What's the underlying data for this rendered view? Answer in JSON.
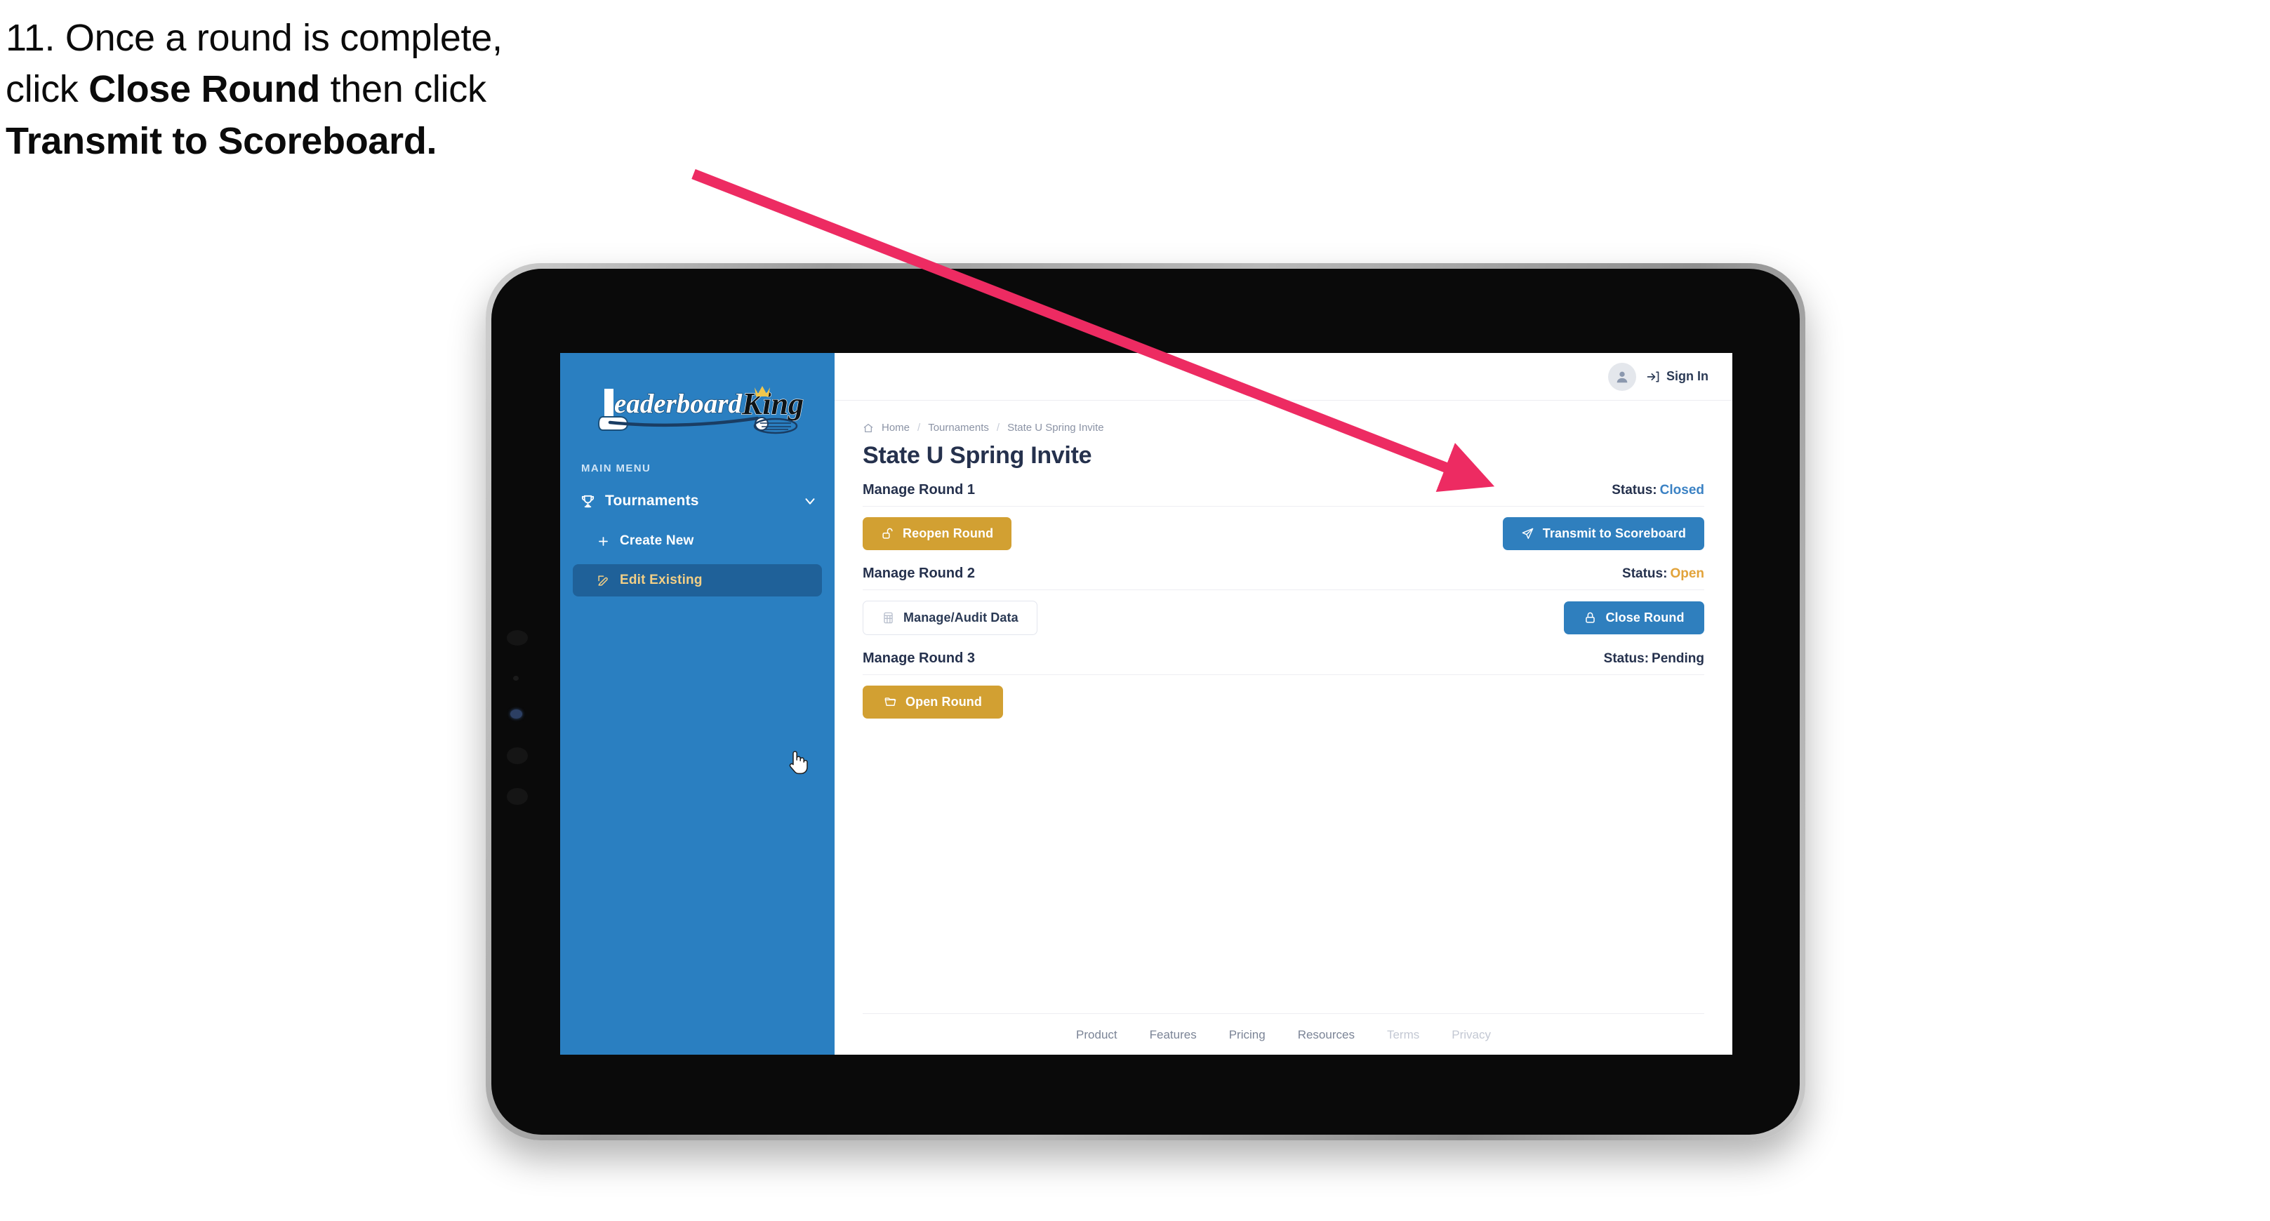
{
  "annotation": {
    "step_number": "11.",
    "line1_prefix": "11. Once a round is complete,",
    "line2_prefix": "click ",
    "line2_bold": "Close Round",
    "line2_suffix": " then click",
    "line3_bold": "Transmit to Scoreboard.",
    "arrow_color": "#ED2B62"
  },
  "sidebar": {
    "logo_text_primary": "Leaderboard",
    "logo_text_secondary": "King",
    "section_label": "MAIN MENU",
    "nav": [
      {
        "label": "Tournaments",
        "icon": "trophy-icon",
        "chevron": "chevron-down-icon",
        "active": false
      }
    ],
    "sub_items": [
      {
        "label": "Create New",
        "icon": "plus-icon",
        "active": false
      },
      {
        "label": "Edit Existing",
        "icon": "pencil-square-icon",
        "active": true
      }
    ],
    "bg_color": "#2a7fc1",
    "active_bg_color": "#1f6199",
    "active_text_color": "#f2cf86"
  },
  "topbar": {
    "avatar_icon": "user-avatar-icon",
    "signin_icon": "login-icon",
    "signin_label": "Sign In"
  },
  "breadcrumb": {
    "home_icon": "home-icon",
    "items": [
      "Home",
      "Tournaments",
      "State U Spring Invite"
    ],
    "separator": "/"
  },
  "page": {
    "title": "State U Spring Invite"
  },
  "rounds": [
    {
      "title": "Manage Round 1",
      "status_label": "Status:",
      "status_value": "Closed",
      "status_color": "#3b82c4",
      "left_button": {
        "label": "Reopen Round",
        "icon": "unlock-icon",
        "style": "gold"
      },
      "right_button": {
        "label": "Transmit to Scoreboard",
        "icon": "send-icon",
        "style": "blue"
      }
    },
    {
      "title": "Manage Round 2",
      "status_label": "Status:",
      "status_value": "Open",
      "status_color": "#e2a33a",
      "left_button": {
        "label": "Manage/Audit Data",
        "icon": "table-icon",
        "style": "ghost"
      },
      "right_button": {
        "label": "Close Round",
        "icon": "lock-icon",
        "style": "blue"
      }
    },
    {
      "title": "Manage Round 3",
      "status_label": "Status:",
      "status_value": "Pending",
      "status_color": "#25314d",
      "left_button": {
        "label": "Open Round",
        "icon": "folder-open-icon",
        "style": "gold"
      },
      "right_button": null
    }
  ],
  "footer": {
    "links": [
      {
        "label": "Product",
        "dim": false
      },
      {
        "label": "Features",
        "dim": false
      },
      {
        "label": "Pricing",
        "dim": false
      },
      {
        "label": "Resources",
        "dim": false
      },
      {
        "label": "Terms",
        "dim": true
      },
      {
        "label": "Privacy",
        "dim": true
      }
    ]
  }
}
